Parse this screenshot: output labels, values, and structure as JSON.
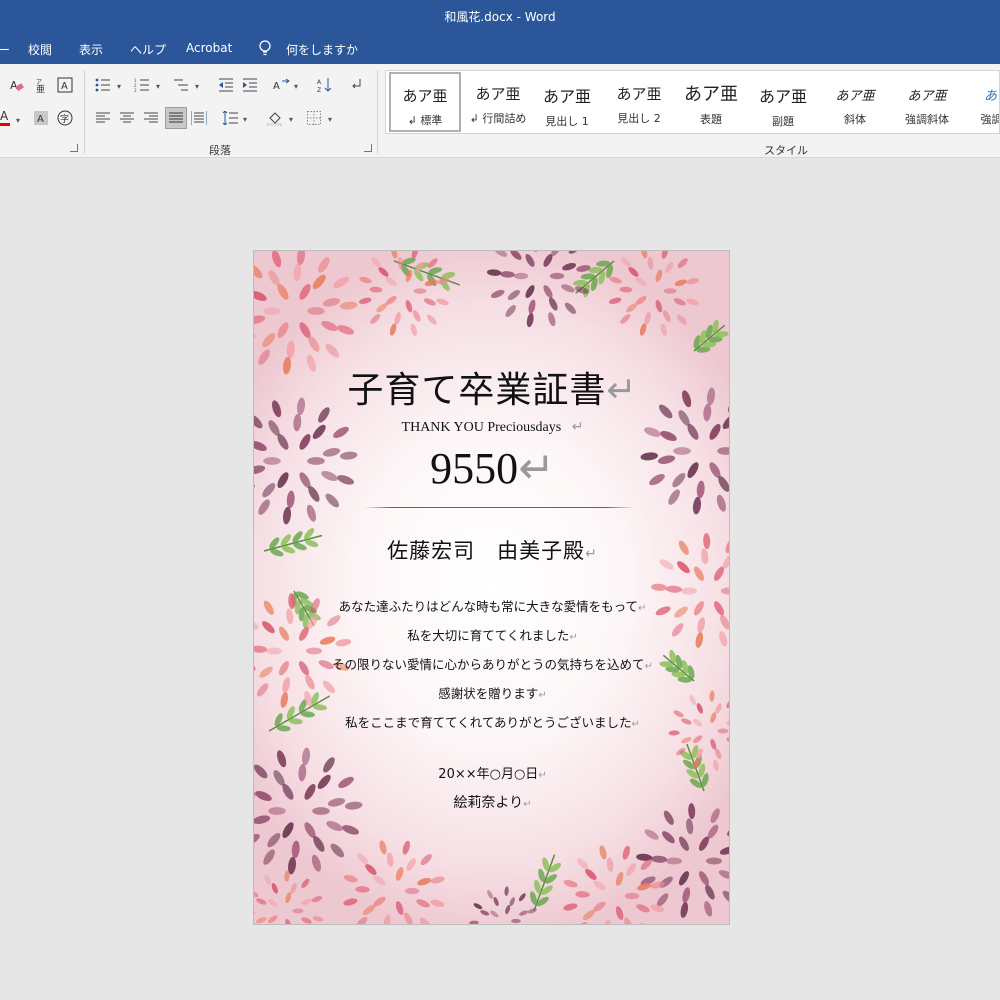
{
  "window": {
    "title": "和風花.docx  -  Word"
  },
  "tabs": [
    "校閲",
    "表示",
    "ヘルプ",
    "Acrobat"
  ],
  "tell_me": "何をしますか",
  "ribbon": {
    "groups": {
      "paragraph": "段落",
      "styles": "スタイル"
    },
    "styles": [
      {
        "sample": "あア亜",
        "name": "↲ 標準"
      },
      {
        "sample": "あア亜",
        "name": "↲ 行間詰め"
      },
      {
        "sample": "あア亜",
        "name": "見出し 1"
      },
      {
        "sample": "あア亜",
        "name": "見出し 2"
      },
      {
        "sample": "あア亜",
        "name": "表題"
      },
      {
        "sample": "あア亜",
        "name": "副題"
      },
      {
        "sample": "あア亜",
        "name": "斜体"
      },
      {
        "sample": "あア亜",
        "name": "強調斜体"
      },
      {
        "sample": "あア",
        "name": "強調斜"
      }
    ]
  },
  "document": {
    "title": "子育て卒業証書",
    "thanks": "THANK YOU Preciousdays",
    "number": "9550",
    "names": "佐藤宏司　由美子殿",
    "body": [
      "あなた達ふたりはどんな時も常に大きな愛情をもって",
      "私を大切に育ててくれました",
      "その限りない愛情に心からありがとうの気持ちを込めて",
      "感謝状を贈ります",
      "私をここまで育ててくれてありがとうございました"
    ],
    "date": "20××年○月○日",
    "from": "絵莉奈より",
    "paragraph_mark": "↵"
  },
  "colors": {
    "title_bar": "#2b579a",
    "ribbon_bg": "#f3f3f3",
    "canvas_bg": "#e6e6e6",
    "flower_pink": "#e0687a",
    "flower_purple": "#7a3554",
    "leaf_green": "#6aa84f"
  }
}
